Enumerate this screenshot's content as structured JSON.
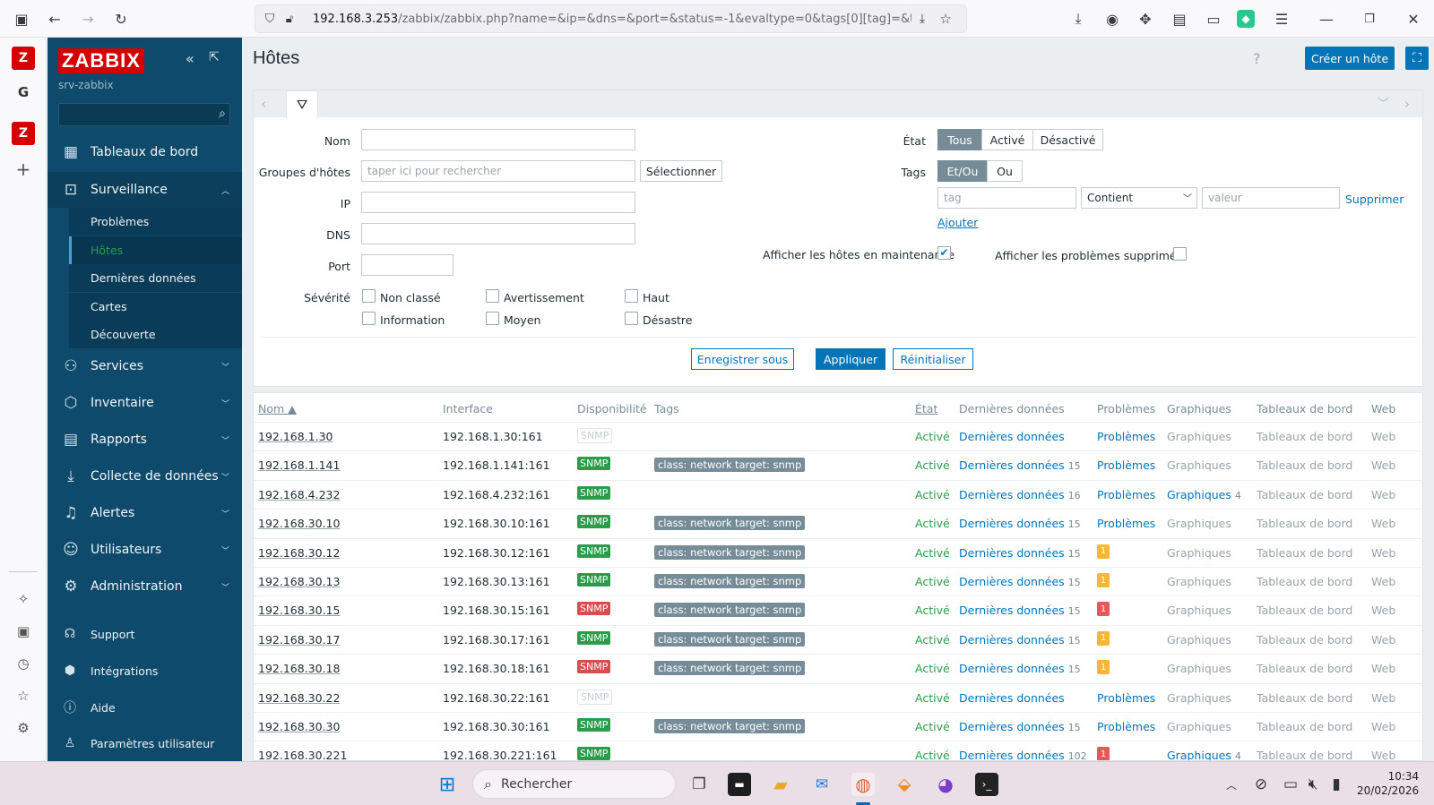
{
  "browser": {
    "url_host": "192.168.3.253",
    "url_path": "/zabbix/zabbix.php?name=&ip=&dns=&port=&status=-1&evaltype=0&tags[0][tag]=&tag"
  },
  "sidebar": {
    "logo": "ZABBIX",
    "server": "srv-zabbix",
    "menu": [
      {
        "label": "Tableaux de bord",
        "icon": "dashboard-icon"
      },
      {
        "label": "Surveillance",
        "icon": "monitoring-icon"
      },
      {
        "label": "Services",
        "icon": "services-icon"
      },
      {
        "label": "Inventaire",
        "icon": "inventory-icon"
      },
      {
        "label": "Rapports",
        "icon": "reports-icon"
      },
      {
        "label": "Collecte de données",
        "icon": "data-collection-icon"
      },
      {
        "label": "Alertes",
        "icon": "alerts-icon"
      },
      {
        "label": "Utilisateurs",
        "icon": "users-icon"
      },
      {
        "label": "Administration",
        "icon": "administration-icon"
      }
    ],
    "submenu": [
      "Problèmes",
      "Hôtes",
      "Dernières données",
      "Cartes",
      "Découverte"
    ],
    "bottom": [
      "Support",
      "Intégrations",
      "Aide",
      "Paramètres utilisateur"
    ]
  },
  "page": {
    "title": "Hôtes",
    "help": "?",
    "create_button": "Créer un hôte"
  },
  "filter": {
    "name_label": "Nom",
    "groups_label": "Groupes d'hôtes",
    "groups_placeholder": "taper ici pour rechercher",
    "select_button": "Sélectionner",
    "ip_label": "IP",
    "dns_label": "DNS",
    "port_label": "Port",
    "severity_label": "Sévérité",
    "severities": [
      "Non classé",
      "Avertissement",
      "Haut",
      "Information",
      "Moyen",
      "Désastre"
    ],
    "state_label": "État",
    "state_options": [
      "Tous",
      "Activé",
      "Désactivé"
    ],
    "tags_label": "Tags",
    "tags_options": [
      "Et/Ou",
      "Ou"
    ],
    "tag_placeholder": "tag",
    "operator": "Contient",
    "value_placeholder": "valeur",
    "remove_link": "Supprimer",
    "add_link": "Ajouter",
    "maintenance_label": "Afficher les hôtes en maintenance",
    "suppressed_label": "Afficher les problèmes supprimés",
    "save_as": "Enregistrer sous",
    "apply": "Appliquer",
    "reset": "Réinitialiser"
  },
  "table": {
    "headers": [
      "Nom ▲",
      "Interface",
      "Disponibilité",
      "Tags",
      "État",
      "Dernières données",
      "Problèmes",
      "Graphiques",
      "Tableaux de bord",
      "Web"
    ],
    "rows": [
      {
        "name": "192.168.1.30",
        "iface": "192.168.1.30:161",
        "snmp": "SNMP",
        "snmp_state": "grey",
        "tags": [],
        "state": "Activé",
        "latest": "Dernières données",
        "latest_count": "",
        "problems": "Problèmes",
        "problems_badge": "",
        "graphs": "Graphiques",
        "graphs_count": "",
        "dash": "Tableaux de bord",
        "web": "Web"
      },
      {
        "name": "192.168.1.141",
        "iface": "192.168.1.141:161",
        "snmp": "SNMP",
        "snmp_state": "green",
        "tags": [
          "class: network",
          "target: snmp"
        ],
        "state": "Activé",
        "latest": "Dernières données",
        "latest_count": "15",
        "problems": "Problèmes",
        "problems_badge": "",
        "graphs": "Graphiques",
        "graphs_count": "",
        "dash": "Tableaux de bord",
        "web": "Web"
      },
      {
        "name": "192.168.4.232",
        "iface": "192.168.4.232:161",
        "snmp": "SNMP",
        "snmp_state": "green",
        "tags": [],
        "state": "Activé",
        "latest": "Dernières données",
        "latest_count": "16",
        "problems": "Problèmes",
        "problems_badge": "",
        "graphs": "Graphiques",
        "graphs_count": "4",
        "dash": "Tableaux de bord",
        "web": "Web"
      },
      {
        "name": "192.168.30.10",
        "iface": "192.168.30.10:161",
        "snmp": "SNMP",
        "snmp_state": "green",
        "tags": [
          "class: network",
          "target: snmp"
        ],
        "state": "Activé",
        "latest": "Dernières données",
        "latest_count": "15",
        "problems": "Problèmes",
        "problems_badge": "",
        "graphs": "Graphiques",
        "graphs_count": "",
        "dash": "Tableaux de bord",
        "web": "Web"
      },
      {
        "name": "192.168.30.12",
        "iface": "192.168.30.12:161",
        "snmp": "SNMP",
        "snmp_state": "green",
        "tags": [
          "class: network",
          "target: snmp"
        ],
        "state": "Activé",
        "latest": "Dernières données",
        "latest_count": "15",
        "problems": "",
        "problems_badge": "1",
        "badge_color": "y",
        "graphs": "Graphiques",
        "graphs_count": "",
        "dash": "Tableaux de bord",
        "web": "Web"
      },
      {
        "name": "192.168.30.13",
        "iface": "192.168.30.13:161",
        "snmp": "SNMP",
        "snmp_state": "green",
        "tags": [
          "class: network",
          "target: snmp"
        ],
        "state": "Activé",
        "latest": "Dernières données",
        "latest_count": "15",
        "problems": "",
        "problems_badge": "1",
        "badge_color": "y",
        "graphs": "Graphiques",
        "graphs_count": "",
        "dash": "Tableaux de bord",
        "web": "Web"
      },
      {
        "name": "192.168.30.15",
        "iface": "192.168.30.15:161",
        "snmp": "SNMP",
        "snmp_state": "red",
        "tags": [
          "class: network",
          "target: snmp"
        ],
        "state": "Activé",
        "latest": "Dernières données",
        "latest_count": "15",
        "problems": "",
        "problems_badge": "1",
        "badge_color": "r",
        "graphs": "Graphiques",
        "graphs_count": "",
        "dash": "Tableaux de bord",
        "web": "Web"
      },
      {
        "name": "192.168.30.17",
        "iface": "192.168.30.17:161",
        "snmp": "SNMP",
        "snmp_state": "green",
        "tags": [
          "class: network",
          "target: snmp"
        ],
        "state": "Activé",
        "latest": "Dernières données",
        "latest_count": "15",
        "problems": "",
        "problems_badge": "1",
        "badge_color": "y",
        "graphs": "Graphiques",
        "graphs_count": "",
        "dash": "Tableaux de bord",
        "web": "Web"
      },
      {
        "name": "192.168.30.18",
        "iface": "192.168.30.18:161",
        "snmp": "SNMP",
        "snmp_state": "red",
        "tags": [
          "class: network",
          "target: snmp"
        ],
        "state": "Activé",
        "latest": "Dernières données",
        "latest_count": "15",
        "problems": "",
        "problems_badge": "1",
        "badge_color": "y",
        "graphs": "Graphiques",
        "graphs_count": "",
        "dash": "Tableaux de bord",
        "web": "Web"
      },
      {
        "name": "192.168.30.22",
        "iface": "192.168.30.22:161",
        "snmp": "SNMP",
        "snmp_state": "grey",
        "tags": [],
        "state": "Activé",
        "latest": "Dernières données",
        "latest_count": "",
        "problems": "Problèmes",
        "problems_badge": "",
        "graphs": "Graphiques",
        "graphs_count": "",
        "dash": "Tableaux de bord",
        "web": "Web"
      },
      {
        "name": "192.168.30.30",
        "iface": "192.168.30.30:161",
        "snmp": "SNMP",
        "snmp_state": "green",
        "tags": [
          "class: network",
          "target: snmp"
        ],
        "state": "Activé",
        "latest": "Dernières données",
        "latest_count": "15",
        "problems": "Problèmes",
        "problems_badge": "",
        "graphs": "Graphiques",
        "graphs_count": "",
        "dash": "Tableaux de bord",
        "web": "Web"
      },
      {
        "name": "192.168.30.221",
        "iface": "192.168.30.221:161",
        "snmp": "SNMP",
        "snmp_state": "green",
        "tags": [],
        "state": "Activé",
        "latest": "Dernières données",
        "latest_count": "102",
        "problems": "",
        "problems_badge": "1",
        "badge_color": "r",
        "graphs": "Graphiques",
        "graphs_count": "4",
        "dash": "Tableaux de bord",
        "web": "Web"
      }
    ]
  },
  "taskbar": {
    "search": "Rechercher",
    "time": "10:34",
    "date": "20/02/2026"
  },
  "colors": {
    "sidebar": "#0e4a6b",
    "accent": "#0275b8",
    "ok": "#2b9c4a",
    "bad": "#d64e4e",
    "warn": "#f7b733"
  }
}
